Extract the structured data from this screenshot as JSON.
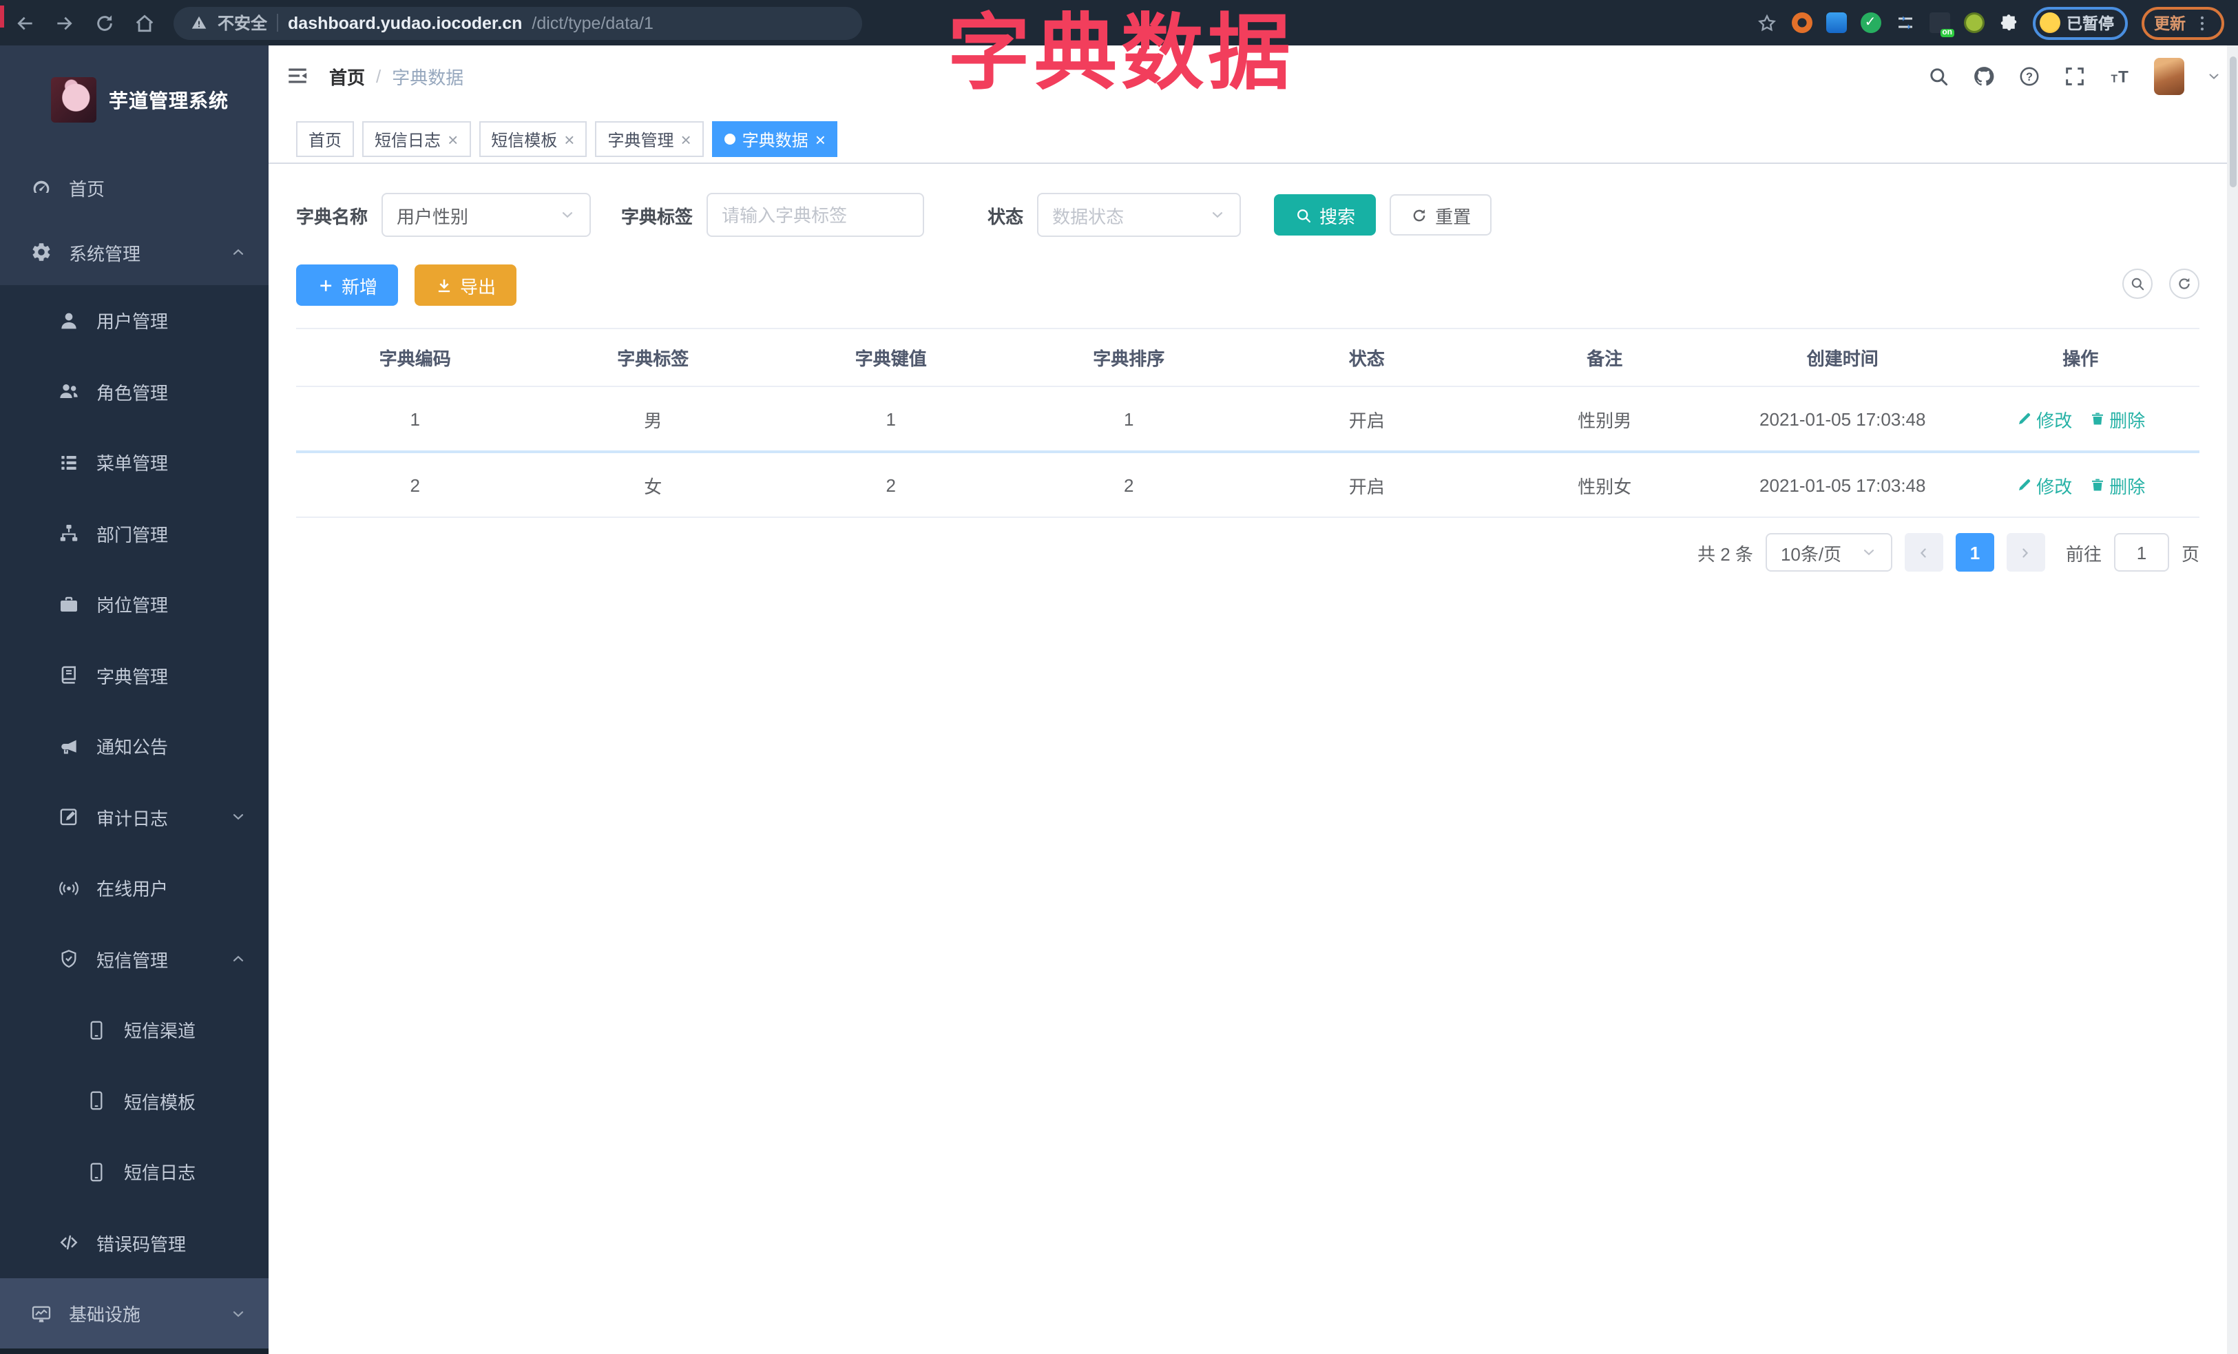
{
  "browser": {
    "security": "不安全",
    "url_host": "dashboard.yudao.iocoder.cn",
    "url_path": "/dict/type/data/1",
    "paused": "已暂停",
    "update": "更新",
    "on_badge": "on"
  },
  "overlay": {
    "title": "字典数据",
    "color": "#f23e5c"
  },
  "app": {
    "title": "芋道管理系统"
  },
  "breadcrumb": {
    "home": "首页",
    "separator": "/",
    "current": "字典数据"
  },
  "tabs": [
    {
      "label": "首页",
      "closable": false,
      "active": false
    },
    {
      "label": "短信日志",
      "closable": true,
      "active": false
    },
    {
      "label": "短信模板",
      "closable": true,
      "active": false
    },
    {
      "label": "字典管理",
      "closable": true,
      "active": false
    },
    {
      "label": "字典数据",
      "closable": true,
      "active": true
    }
  ],
  "ui": {
    "close_glyph": "×"
  },
  "sidebar": {
    "items": [
      {
        "label": "首页"
      },
      {
        "label": "系统管理"
      },
      {
        "label": "用户管理"
      },
      {
        "label": "角色管理"
      },
      {
        "label": "菜单管理"
      },
      {
        "label": "部门管理"
      },
      {
        "label": "岗位管理"
      },
      {
        "label": "字典管理"
      },
      {
        "label": "通知公告"
      },
      {
        "label": "审计日志"
      },
      {
        "label": "在线用户"
      },
      {
        "label": "短信管理"
      },
      {
        "label": "短信渠道"
      },
      {
        "label": "短信模板"
      },
      {
        "label": "短信日志"
      },
      {
        "label": "错误码管理"
      },
      {
        "label": "基础设施"
      }
    ]
  },
  "search": {
    "name_label": "字典名称",
    "name_value": "用户性别",
    "tag_label": "字典标签",
    "tag_placeholder": "请输入字典标签",
    "status_label": "状态",
    "status_placeholder": "数据状态",
    "search": "搜索",
    "reset": "重置"
  },
  "toolbar": {
    "add": "新增",
    "export": "导出"
  },
  "table": {
    "columns": [
      "字典编码",
      "字典标签",
      "字典键值",
      "字典排序",
      "状态",
      "备注",
      "创建时间",
      "操作"
    ],
    "rows": [
      {
        "code": "1",
        "tag": "男",
        "value": "1",
        "sort": "1",
        "status": "开启",
        "remark": "性别男",
        "created": "2021-01-05 17:03:48"
      },
      {
        "code": "2",
        "tag": "女",
        "value": "2",
        "sort": "2",
        "status": "开启",
        "remark": "性别女",
        "created": "2021-01-05 17:03:48"
      }
    ],
    "actions": {
      "edit": "修改",
      "delete": "删除"
    }
  },
  "pagination": {
    "total": "共 2 条",
    "page_size": "10条/页",
    "current": "1",
    "goto_label": "前往",
    "goto_value": "1",
    "goto_unit": "页"
  },
  "colors": {
    "primary": "#409eff",
    "teal": "#17b1a4",
    "warning": "#eba52f",
    "overlay_red": "#f23e5c",
    "sidebar_bg": "#2e3b50",
    "submenu_bg": "#212e40",
    "infra_bg": "#3e4c66",
    "chrome_bg": "#1e2936"
  }
}
